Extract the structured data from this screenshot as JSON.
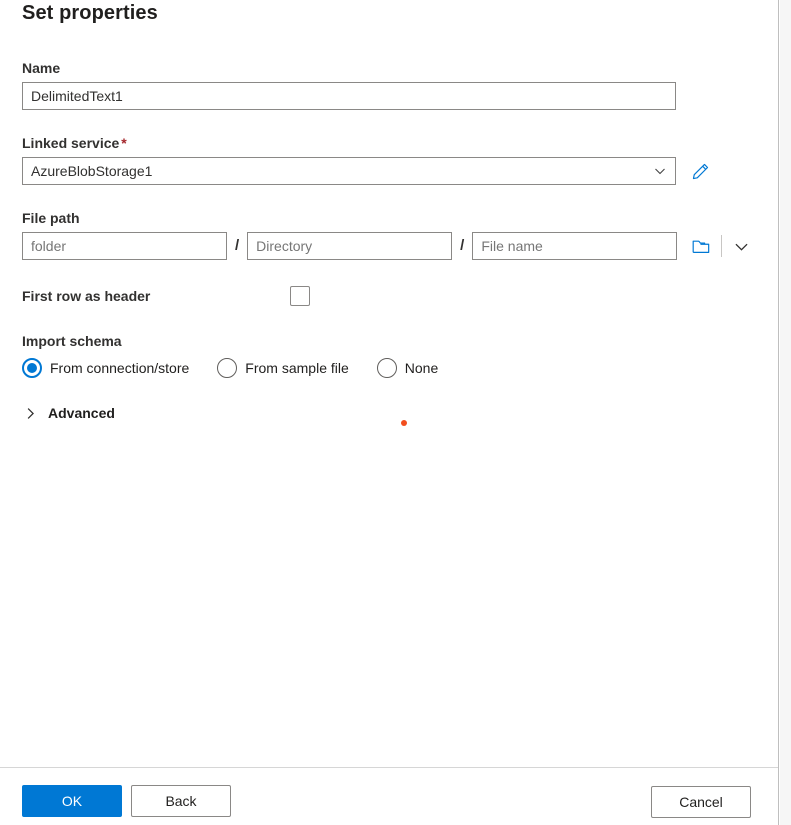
{
  "dialog": {
    "title": "Set properties"
  },
  "fields": {
    "name": {
      "label": "Name",
      "value": "DelimitedText1",
      "placeholder": ""
    },
    "linked_service": {
      "label": "Linked service",
      "required_marker": "*",
      "value": "AzureBlobStorage1",
      "edit_icon": "pencil-icon",
      "caret_icon": "chevron-down-icon"
    },
    "file_path": {
      "label": "File path",
      "container_placeholder": "folder",
      "container_value": "",
      "separator": "/",
      "directory_placeholder": "Directory",
      "directory_value": "",
      "file_name_placeholder": "File name",
      "file_name_value": "",
      "browse_icon": "folder-icon",
      "caret_icon": "chevron-down-icon"
    },
    "first_row_as_header": {
      "label": "First row as header",
      "checked": false
    },
    "import_schema": {
      "label": "Import schema",
      "selected": "From connection/store",
      "options": [
        {
          "label": "From connection/store",
          "checked": true
        },
        {
          "label": "From sample file",
          "checked": false
        },
        {
          "label": "None",
          "checked": false
        }
      ]
    },
    "advanced": {
      "label": "Advanced",
      "expanded": false,
      "caret_icon": "chevron-right-icon"
    }
  },
  "footer": {
    "ok_label": "OK",
    "back_label": "Back",
    "cancel_label": "Cancel"
  },
  "colors": {
    "accent": "#0078d4",
    "required": "#a4262c",
    "cursor_dot": "#f24e1e",
    "border": "#8a8886",
    "text": "#201f1e"
  }
}
